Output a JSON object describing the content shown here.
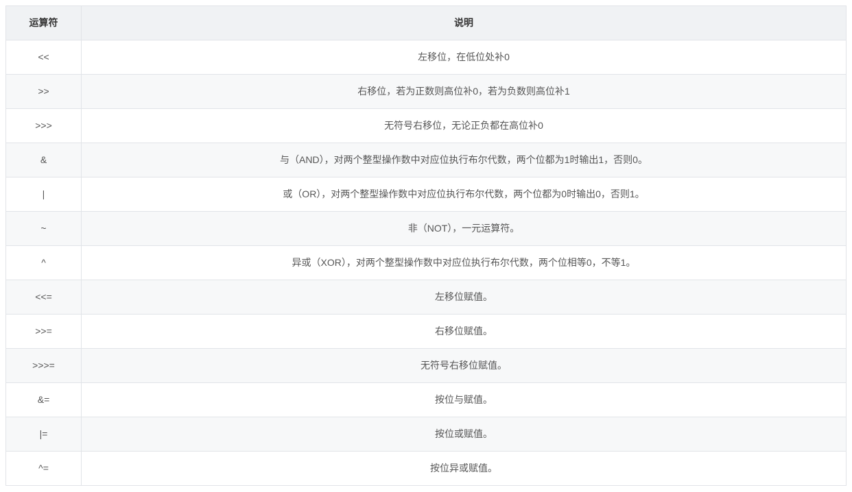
{
  "table": {
    "headers": {
      "operator": "运算符",
      "description": "说明"
    },
    "rows": [
      {
        "operator": "<<",
        "description": "左移位，在低位处补0"
      },
      {
        "operator": ">>",
        "description": "右移位，若为正数则高位补0，若为负数则高位补1"
      },
      {
        "operator": ">>>",
        "description": "无符号右移位，无论正负都在高位补0"
      },
      {
        "operator": "&",
        "description": "与（AND），对两个整型操作数中对应位执行布尔代数，两个位都为1时输出1，否则0。"
      },
      {
        "operator": "|",
        "description": "或（OR），对两个整型操作数中对应位执行布尔代数，两个位都为0时输出0，否则1。"
      },
      {
        "operator": "~",
        "description": "非（NOT），一元运算符。"
      },
      {
        "operator": "^",
        "description": "异或（XOR），对两个整型操作数中对应位执行布尔代数，两个位相等0，不等1。"
      },
      {
        "operator": "<<=",
        "description": "左移位赋值。"
      },
      {
        "operator": ">>=",
        "description": "右移位赋值。"
      },
      {
        "operator": ">>>=",
        "description": "无符号右移位赋值。"
      },
      {
        "operator": "&=",
        "description": "按位与赋值。"
      },
      {
        "operator": "|=",
        "description": "按位或赋值。"
      },
      {
        "operator": "^=",
        "description": "按位异或赋值。"
      }
    ]
  }
}
